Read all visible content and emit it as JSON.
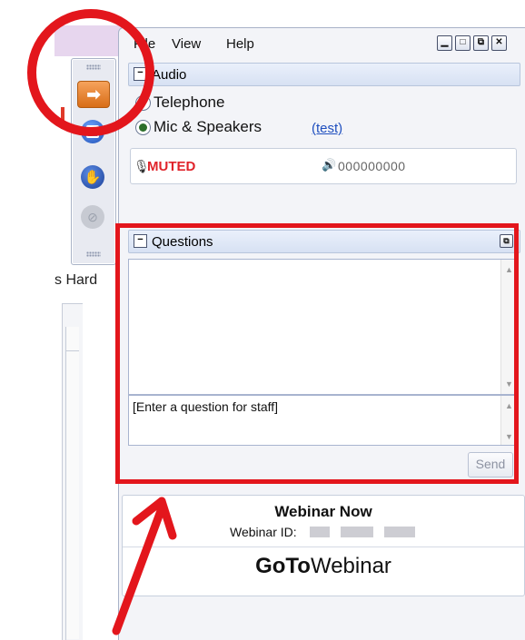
{
  "background": {
    "partial_text": "s Hard"
  },
  "panel": {
    "menu": [
      "File",
      "View",
      "Help"
    ],
    "window_buttons": [
      "minimize",
      "restore",
      "popout",
      "close"
    ],
    "audio": {
      "title": "Audio",
      "options": [
        {
          "label": "Telephone",
          "selected": false
        },
        {
          "label": "Mic & Speakers",
          "selected": true
        }
      ],
      "test_link": "(test)",
      "status": "MUTED",
      "level": "000000000"
    },
    "questions": {
      "title": "Questions",
      "input_placeholder": "[Enter a question for staff]",
      "send_label": "Send"
    },
    "webinar": {
      "title": "Webinar Now",
      "id_label": "Webinar ID:",
      "brand_bold": "GoTo",
      "brand_rest": "Webinar"
    }
  },
  "colors": {
    "annotation_red": "#e3161c",
    "muted_red": "#e0232a",
    "link_blue": "#1f4fbf"
  }
}
